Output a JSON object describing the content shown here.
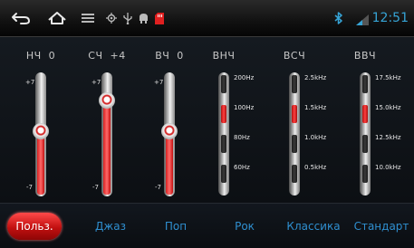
{
  "status_bar": {
    "time": "12:51",
    "icons": [
      "back-icon",
      "home-icon",
      "menu-icon",
      "gps-icon",
      "usb-icon",
      "android-debug-icon",
      "sd-card-icon",
      "bluetooth-icon",
      "signal-icon"
    ],
    "accent_color": "#36a4d6",
    "alert_color": "#e02020"
  },
  "equalizer": {
    "sliders": [
      {
        "name": "НЧ",
        "value_text": "0",
        "max_label": "+7",
        "min_label": "-7",
        "value": 0
      },
      {
        "name": "СЧ",
        "value_text": "+4",
        "max_label": "+7",
        "min_label": "-7",
        "value": 4
      },
      {
        "name": "ВЧ",
        "value_text": "0",
        "max_label": "+7",
        "min_label": "-7",
        "value": 0
      }
    ],
    "band_selectors": [
      {
        "name": "ВНЧ",
        "options": [
          "200Hz",
          "100Hz",
          "80Hz",
          "60Hz"
        ],
        "selected": "100Hz"
      },
      {
        "name": "ВСЧ",
        "options": [
          "2.5kHz",
          "1.5kHz",
          "1.0kHz",
          "0.5kHz"
        ],
        "selected": "1.5kHz"
      },
      {
        "name": "ВВЧ",
        "options": [
          "17.5kHz",
          "15.0kHz",
          "12.5kHz",
          "10.0kHz"
        ],
        "selected": "15.0kHz"
      }
    ]
  },
  "presets": {
    "items": [
      "Польз.",
      "Джаз",
      "Поп",
      "Рок",
      "Классика",
      "Стандарт"
    ],
    "selected": "Польз."
  }
}
